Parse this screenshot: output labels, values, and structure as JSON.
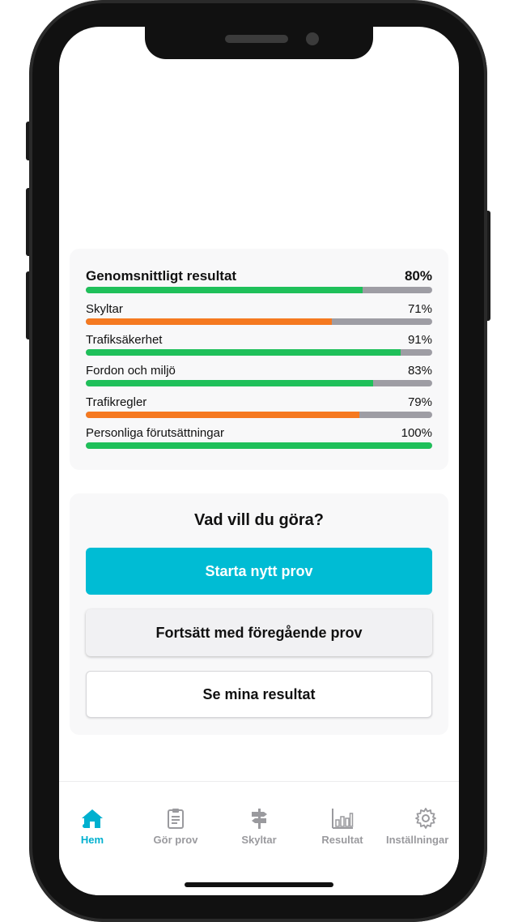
{
  "results": {
    "overall": {
      "label": "Genomsnittligt resultat",
      "percent": "80%",
      "value": 80
    },
    "categories": [
      {
        "label": "Skyltar",
        "percent": "71%",
        "value": 71,
        "color": "orange"
      },
      {
        "label": "Trafiksäkerhet",
        "percent": "91%",
        "value": 91,
        "color": "green"
      },
      {
        "label": "Fordon och miljö",
        "percent": "83%",
        "value": 83,
        "color": "green"
      },
      {
        "label": "Trafikregler",
        "percent": "79%",
        "value": 79,
        "color": "orange"
      },
      {
        "label": "Personliga förutsättningar",
        "percent": "100%",
        "value": 100,
        "color": "green"
      }
    ]
  },
  "actions": {
    "title": "Vad vill du göra?",
    "start_label": "Starta nytt prov",
    "continue_label": "Fortsätt med föregående prov",
    "results_label": "Se mina resultat"
  },
  "tabs": [
    {
      "label": "Hem",
      "icon": "home-icon",
      "active": true
    },
    {
      "label": "Gör prov",
      "icon": "clipboard-icon",
      "active": false
    },
    {
      "label": "Skyltar",
      "icon": "signpost-icon",
      "active": false
    },
    {
      "label": "Resultat",
      "icon": "bar-chart-icon",
      "active": false
    },
    {
      "label": "Inställningar",
      "icon": "gear-icon",
      "active": false
    }
  ],
  "colors": {
    "accent": "#00bcd4",
    "green": "#1fc05a",
    "orange": "#f57920",
    "track": "#9e9da4"
  }
}
